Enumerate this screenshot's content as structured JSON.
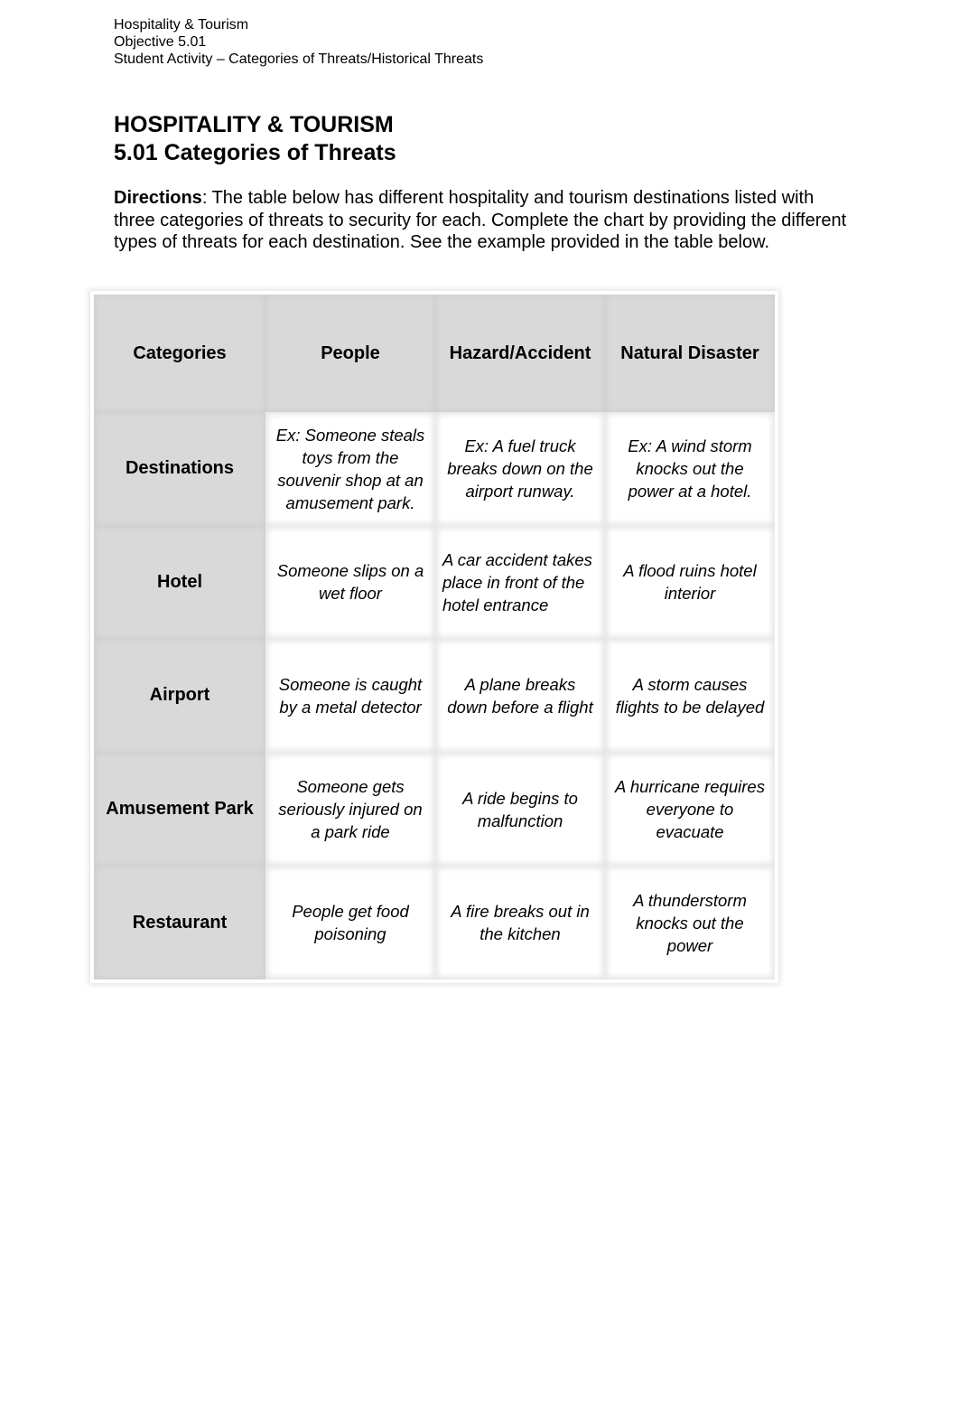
{
  "header": {
    "line1": "Hospitality & Tourism",
    "line2": "Objective 5.01",
    "line3": "Student Activity – Categories of Threats/Historical Threats"
  },
  "title": {
    "main": "HOSPITALITY & TOURISM",
    "sub": "5.01 Categories of Threats"
  },
  "directions": {
    "label": "Directions",
    "text": ": The table below has different hospitality and tourism destinations listed with three categories of threats to security for each. Complete the chart by providing the different types of threats for each destination. See the example provided in the table below."
  },
  "table": {
    "colors": {
      "header_bg": "#d9d9d9",
      "cell_bg": "#ffffff"
    },
    "headers": [
      "Categories",
      "People",
      "Hazard/Accident",
      "Natural Disaster"
    ],
    "rows": [
      {
        "category": "Destinations",
        "people": "Ex: Someone steals toys from the souvenir shop at an amusement park.",
        "hazard": "Ex: A fuel truck breaks down on the airport runway.",
        "natural": "Ex: A wind storm knocks out the power at a hotel."
      },
      {
        "category": "Hotel",
        "people": "Someone slips on a wet floor",
        "hazard": "A car accident takes place in front of the hotel entrance",
        "natural": "A flood ruins hotel interior"
      },
      {
        "category": "Airport",
        "people": "Someone is caught by a metal detector",
        "hazard": "A plane breaks down before a flight",
        "natural": "A storm causes flights to be delayed"
      },
      {
        "category": "Amusement Park",
        "people": "Someone gets seriously injured on a park ride",
        "hazard": "A ride begins to malfunction",
        "natural": "A hurricane requires everyone to evacuate"
      },
      {
        "category": "Restaurant",
        "people": "People get food poisoning",
        "hazard": "A fire breaks out in the kitchen",
        "natural": "A thunderstorm knocks out the power"
      }
    ]
  }
}
